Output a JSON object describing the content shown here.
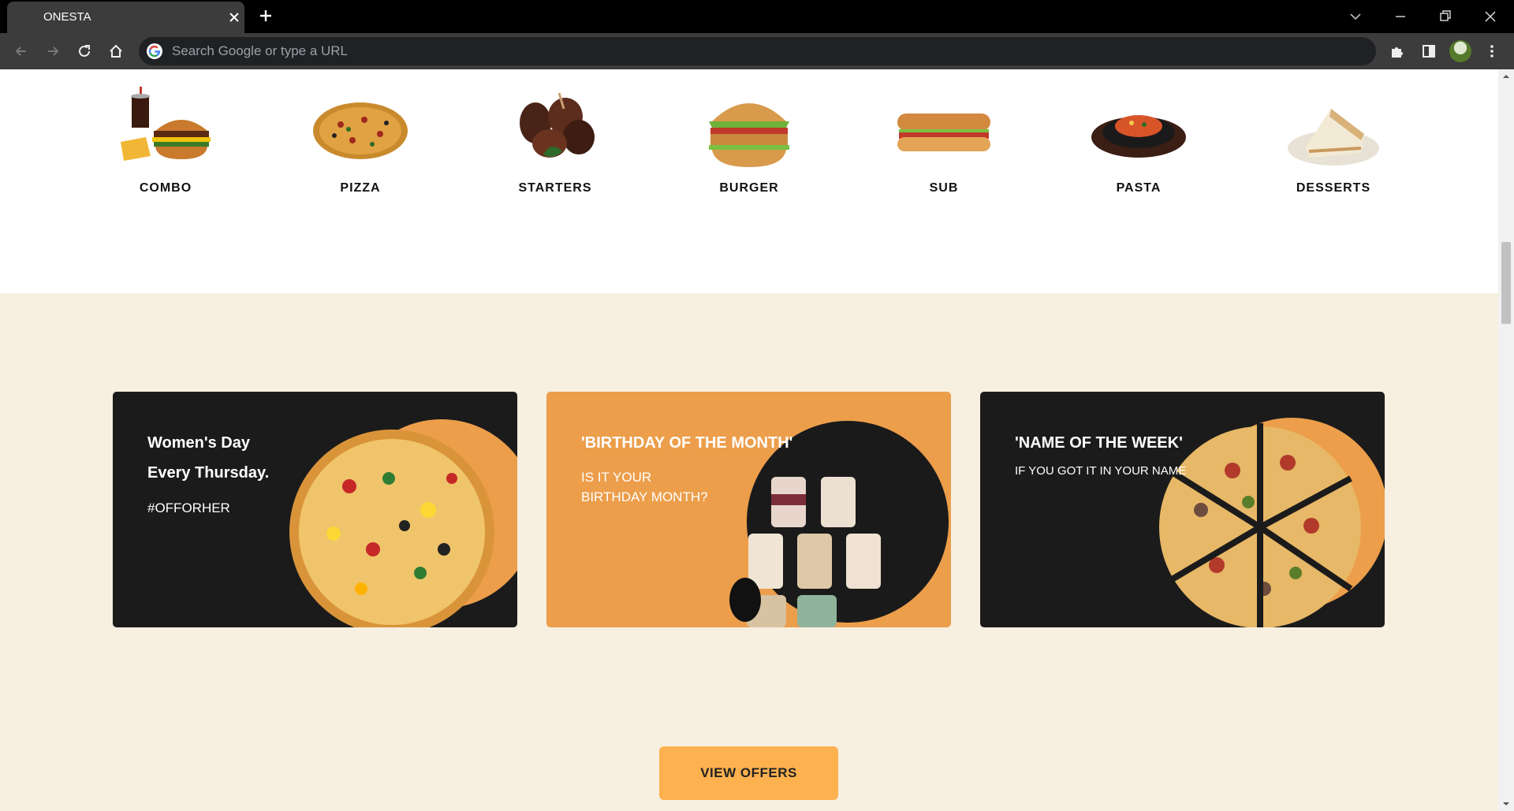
{
  "browser": {
    "tab_title": "ONESTA",
    "omnibox_placeholder": "Search Google or type a URL"
  },
  "categories": [
    {
      "label": "COMBO",
      "icon": "combo-meal-image"
    },
    {
      "label": "PIZZA",
      "icon": "pizza-image"
    },
    {
      "label": "STARTERS",
      "icon": "starters-image"
    },
    {
      "label": "BURGER",
      "icon": "burger-image"
    },
    {
      "label": "SUB",
      "icon": "sub-sandwich-image"
    },
    {
      "label": "PASTA",
      "icon": "pasta-image"
    },
    {
      "label": "DESSERTS",
      "icon": "dessert-image"
    }
  ],
  "offers": [
    {
      "title_line1": "Women's Day",
      "title_line2": "Every Thursday.",
      "tag": "#OFFORHER",
      "image": "veg-pizza-image"
    },
    {
      "title": "'BIRTHDAY OF THE MONTH'",
      "line1": "IS IT YOUR",
      "line2": "BIRTHDAY MONTH?",
      "image": "dessert-jars-image"
    },
    {
      "title": "'NAME OF THE WEEK'",
      "subtitle": "IF YOU GOT IT IN YOUR NAME",
      "image": "sliced-pizza-image"
    }
  ],
  "cta_label": "VIEW OFFERS",
  "colors": {
    "accent": "#ec9e4b",
    "button": "#fdb14f",
    "card_dark": "#1b1b1b",
    "section_bg": "#f7efe0"
  }
}
